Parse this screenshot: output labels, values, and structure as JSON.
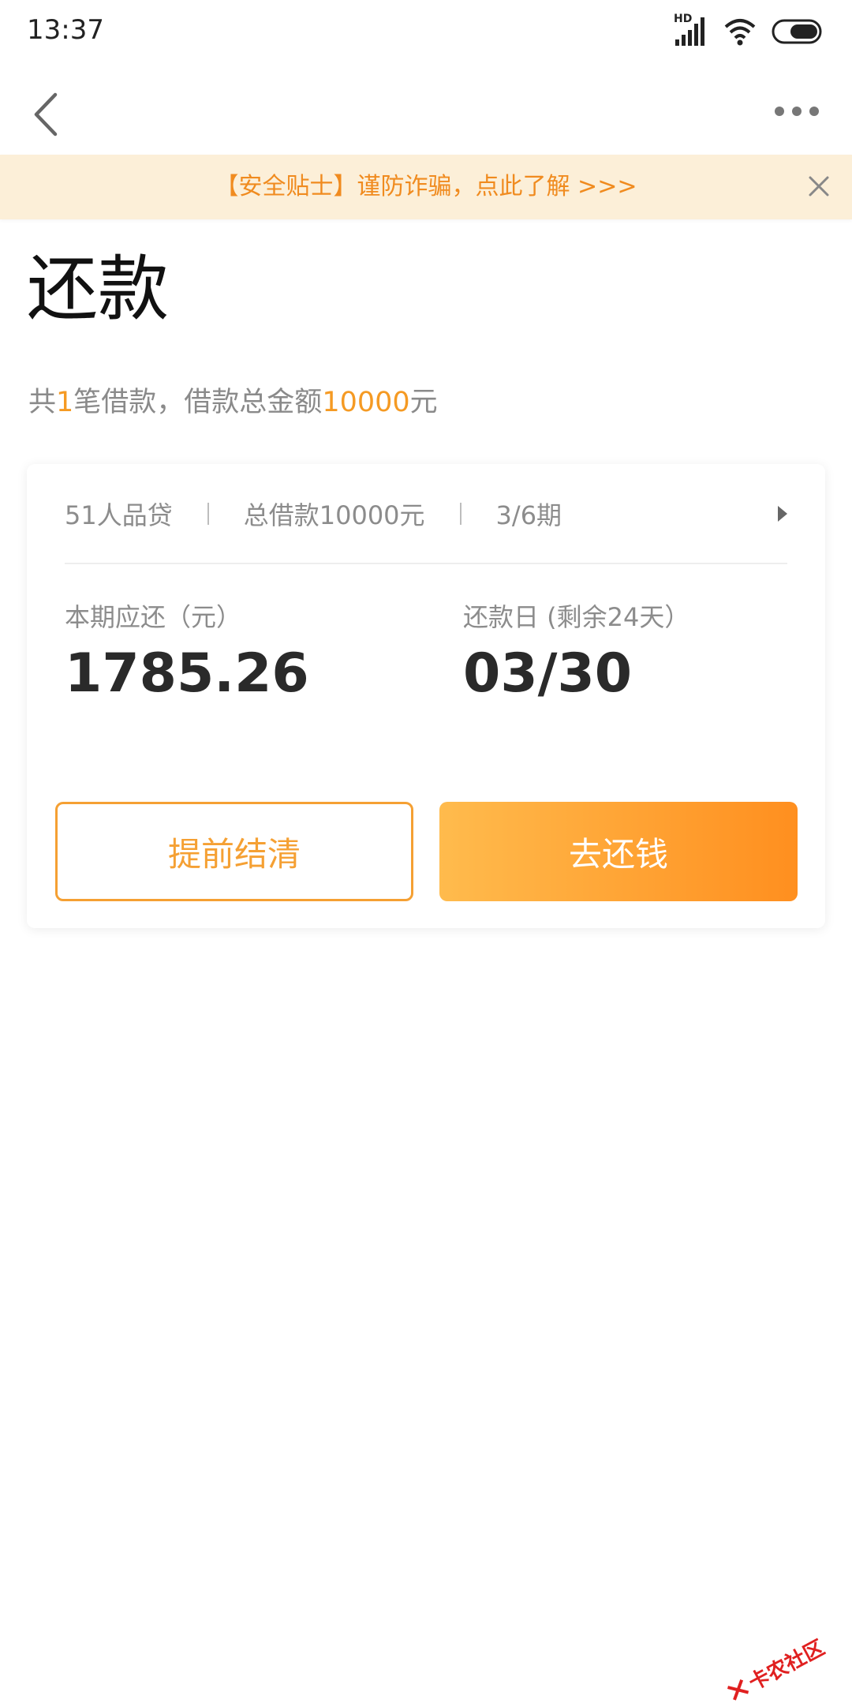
{
  "status_bar": {
    "time": "13:37",
    "network_label": "HD",
    "icons": [
      "signal-icon",
      "wifi-icon",
      "battery-icon"
    ]
  },
  "nav": {
    "back_icon": "chevron-left-icon",
    "more_icon": "more-dots-icon"
  },
  "banner": {
    "text": "【安全贴士】谨防诈骗，点此了解 >>>",
    "close_icon": "close-icon",
    "bg_color": "#fcefd8",
    "text_color": "#f08b1f"
  },
  "page": {
    "title": "还款",
    "summary_prefix": "共",
    "loan_count": "1",
    "summary_mid": "笔借款，借款总金额",
    "total_amount": "10000",
    "summary_suffix": "元"
  },
  "loan_card": {
    "product_name": "51人品贷",
    "total_borrowed": "总借款10000元",
    "period": "3/6期",
    "arrow_icon": "triangle-right-icon",
    "due_label": "本期应还（元）",
    "due_amount": "1785.26",
    "date_label": "还款日 (剩余24天）",
    "due_date": "03/30",
    "settle_button": "提前结清",
    "repay_button": "去还钱"
  },
  "colors": {
    "accent": "#f5a033",
    "gradient_start": "#ffbb4d",
    "gradient_end": "#ff8f1f"
  },
  "watermark": {
    "text": "卡农社区"
  }
}
